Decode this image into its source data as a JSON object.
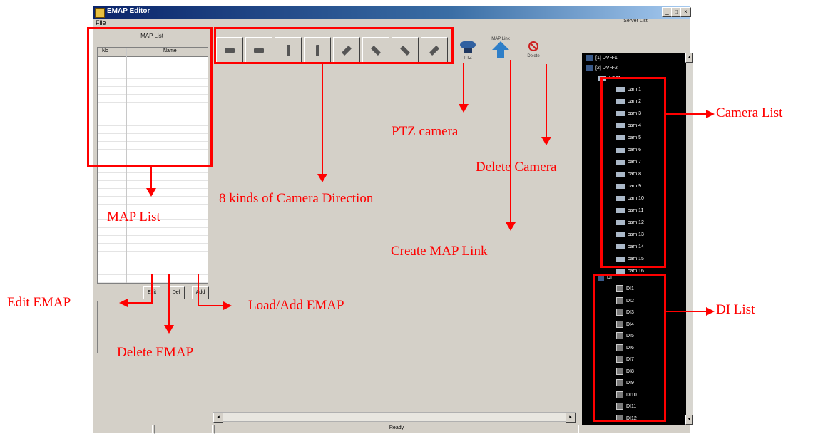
{
  "window": {
    "title": "EMAP Editor",
    "menu": [
      "File"
    ],
    "caption_buttons": [
      "_",
      "□",
      "×"
    ]
  },
  "left_panel": {
    "title": "MAP List",
    "columns": [
      "No",
      "Name"
    ],
    "buttons": {
      "edit": "Edit",
      "del": "Del",
      "add": "Add"
    }
  },
  "toolbar": {
    "direction_buttons": [
      "left",
      "left",
      "up",
      "down",
      "up-right",
      "down-right",
      "up-left",
      "down-left"
    ],
    "ptz_label": "PTZ",
    "maplink_label": "MAP Link",
    "delete_label": "Delete"
  },
  "server_list": {
    "title": "Server List",
    "dvrs": [
      "[1] DVR-1",
      "[2] DVR-2"
    ],
    "cam_group": "CAM",
    "cameras": [
      "cam 1",
      "cam 2",
      "cam 3",
      "cam 4",
      "cam 5",
      "cam 6",
      "cam 7",
      "cam 8",
      "cam 9",
      "cam 10",
      "cam 11",
      "cam 12",
      "cam 13",
      "cam 14",
      "cam 15",
      "cam 16"
    ],
    "di_group": "DI",
    "di": [
      "DI1",
      "DI2",
      "DI3",
      "DI4",
      "DI5",
      "DI6",
      "DI7",
      "DI8",
      "DI9",
      "DI10",
      "DI11",
      "DI12"
    ]
  },
  "status_bar": {
    "text": "Ready"
  },
  "annotations": {
    "map_list": "MAP List",
    "camera_direction": "8 kinds of Camera Direction",
    "ptz_camera": "PTZ camera",
    "delete_camera": "Delete Camera",
    "create_map_link": "Create MAP Link",
    "camera_list": "Camera List",
    "di_list": "DI List",
    "edit_emap": "Edit EMAP",
    "delete_emap": "Delete EMAP",
    "load_add_emap": "Load/Add EMAP"
  },
  "colors": {
    "annotation": "#ff0000",
    "window_bg": "#d4d0c8",
    "tree_bg": "#000000"
  }
}
